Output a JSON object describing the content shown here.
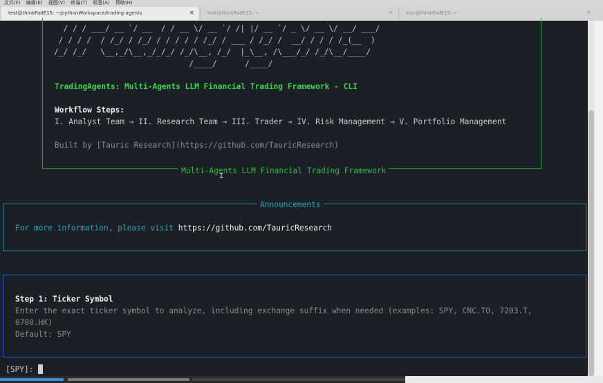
{
  "menubar": {
    "items": [
      "文件(F)",
      "编辑(E)",
      "视图(V)",
      "终端(T)",
      "标签(A)",
      "帮助(H)"
    ]
  },
  "tabs": [
    {
      "title": "test@thinkPadE15: ~/pythonWorkspace/trading-agents",
      "close": "×"
    },
    {
      "title": "test@thinkPadE15: ~",
      "close": "×"
    },
    {
      "title": "test@thinkPadE15: ~",
      "close": "×"
    }
  ],
  "banner": {
    "art": [
      "  / / / ___/ __ `/ __  / / __ \\/ __ `/ /| |/ __ `/ _ \\/ __ \\/ __/ ___/",
      " / / / /  / /_/ / /_/ / / / / / /_/ / ___ / /_/ /  __/ / / / /_(__  )",
      "/_/ /_/   \\__,_/\\__,_/_/_/ /_/\\__, /_/  |_\\__, /\\___/_/ /_/\\__/____/",
      "                             /____/      /____/"
    ],
    "title": "TradingAgents: Multi-Agents LLM Financial Trading Framework - CLI",
    "workflow_heading": "Workflow Steps:",
    "workflow_steps": "I. Analyst Team → II. Research Team → III. Trader → IV. Risk Management → V. Portfolio Management",
    "built_by": "Built by [Tauric Research](https://github.com/TauricResearch)",
    "footer": "Multi-Agents LLM Financial Trading Framework"
  },
  "announcements": {
    "title": "Announcements",
    "text": "For more information, please visit ",
    "link": "https://github.com/TauricResearch"
  },
  "step": {
    "heading": "Step 1: Ticker Symbol",
    "description_line1": "Enter the exact ticker symbol to analyze, including exchange suffix when needed (examples: SPY, CNC.TO, 7203.T,",
    "description_line2": "0700.HK)",
    "default": "Default: SPY"
  },
  "prompt": {
    "text": "[SPY]: "
  },
  "colors": {
    "background": "#1b1f26",
    "green": "#3fd24b",
    "cyan": "#2aa3b8",
    "blue_border": "#2a55c8"
  }
}
